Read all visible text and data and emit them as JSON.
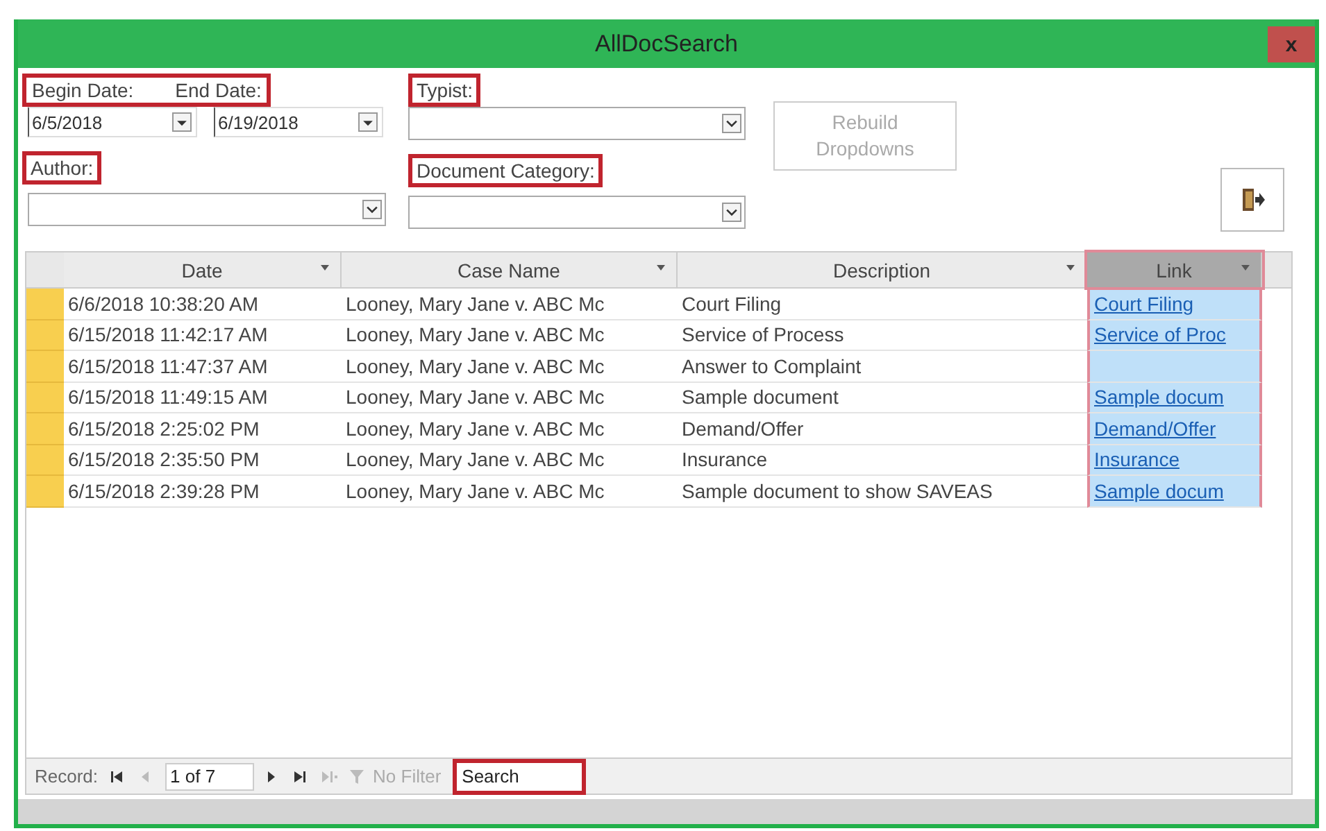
{
  "window": {
    "title": "AllDocSearch",
    "close": "x"
  },
  "filters": {
    "date_group": {
      "highlighted": true,
      "begin_label": "Begin Date:",
      "end_label": "End Date:",
      "begin_value": "6/5/2018",
      "end_value": "6/19/2018"
    },
    "typist": {
      "label": "Typist:",
      "highlighted": true
    },
    "author": {
      "label": "Author:",
      "highlighted": true
    },
    "category": {
      "label": "Document Category:",
      "highlighted": true
    },
    "rebuild_button": {
      "label": "Rebuild Dropdowns",
      "disabled": true
    }
  },
  "table": {
    "columns": [
      {
        "label": "Date",
        "selected": false
      },
      {
        "label": "Case Name",
        "selected": false
      },
      {
        "label": "Description",
        "selected": false
      },
      {
        "label": "Link",
        "selected": true
      }
    ],
    "rows": [
      {
        "date": "6/6/2018 10:38:20 AM",
        "case": "Looney, Mary Jane v. ABC Mc",
        "description": "Court Filing",
        "link": "Court Filing"
      },
      {
        "date": "6/15/2018 11:42:17 AM",
        "case": "Looney, Mary Jane v. ABC Mc",
        "description": "Service of Process",
        "link": "Service of Proc"
      },
      {
        "date": "6/15/2018 11:47:37 AM",
        "case": "Looney, Mary Jane v. ABC Mc",
        "description": "Answer to Complaint"
      },
      {
        "date": "6/15/2018 11:49:15 AM",
        "case": "Looney, Mary Jane v. ABC Mc",
        "description": "Sample document",
        "link": "Sample docum"
      },
      {
        "date": "6/15/2018 2:25:02 PM",
        "case": "Looney, Mary Jane v. ABC Mc",
        "description": "Demand/Offer",
        "link": "Demand/Offer"
      },
      {
        "date": "6/15/2018 2:35:50 PM",
        "case": "Looney, Mary Jane v. ABC Mc",
        "description": "Insurance",
        "link": "Insurance"
      },
      {
        "date": "6/15/2018 2:39:28 PM",
        "case": "Looney, Mary Jane v. ABC Mc",
        "description": "Sample document to show SAVEAS",
        "link": "Sample docum"
      }
    ]
  },
  "navigation": {
    "record_label": "Record:",
    "position": "1 of 7",
    "filter": "No Filter",
    "search": "Search",
    "search_highlighted": true
  }
}
